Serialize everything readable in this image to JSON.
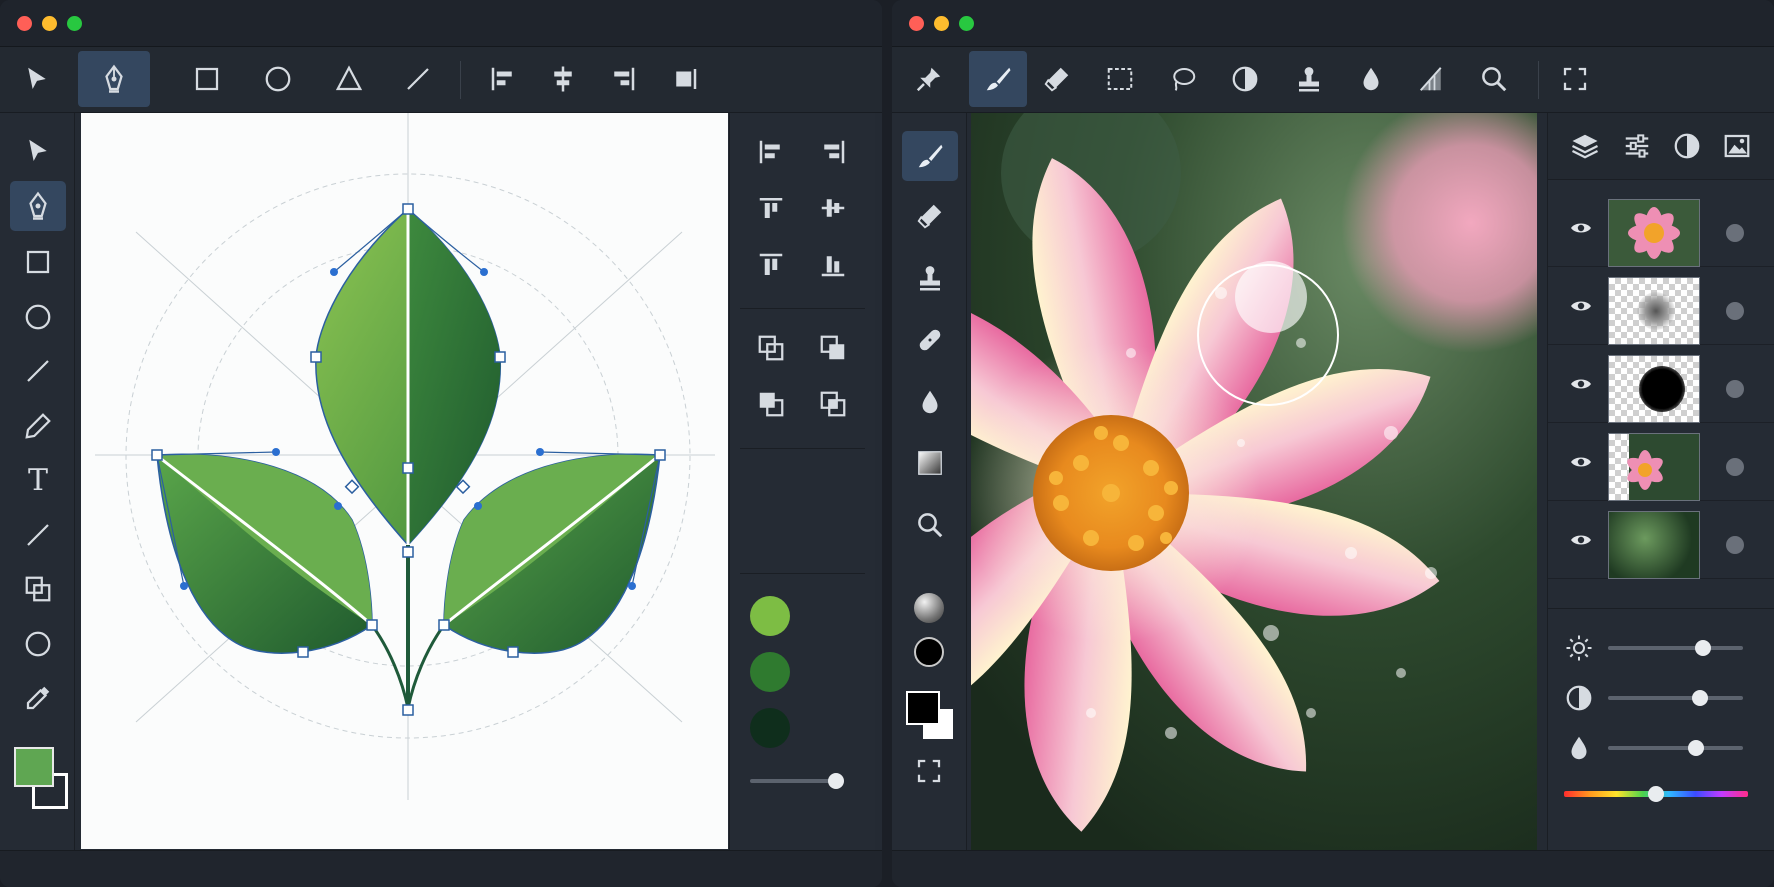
{
  "colors": {
    "close": "#ff5f57",
    "minimize": "#febc2e",
    "zoom": "#28c840",
    "accent": "#34475f",
    "icon": "#d6dbe1"
  },
  "vector_app": {
    "toolbar": [
      "select-icon",
      "pen-icon",
      "rectangle-icon",
      "ellipse-icon",
      "triangle-icon",
      "line-icon",
      "align-left-icon",
      "align-center-icon",
      "align-right-icon",
      "distribute-icon"
    ],
    "active_tool": "pen-icon",
    "left_tools": [
      "select-icon",
      "pen-icon",
      "rectangle-icon",
      "ellipse-icon",
      "line-icon",
      "pencil-icon",
      "text-icon",
      "line-icon",
      "shape-builder-icon",
      "ellipse-icon",
      "eyedropper-icon"
    ],
    "text_tool_glyph": "T",
    "fill_color": "#5fa652",
    "stroke_color": "#ffffff",
    "swatches": [
      "#7dbd44",
      "#2f7a2f",
      "#0f2e1c"
    ],
    "opacity_level": 1.0
  },
  "raster_app": {
    "toolbar": [
      "pin-icon",
      "brush-icon",
      "eraser-icon",
      "marquee-icon",
      "lasso-icon",
      "contrast-icon",
      "stamp-icon",
      "drop-icon",
      "gradient-icon",
      "zoom-icon",
      "fullscreen-icon"
    ],
    "active_tool": "brush-icon",
    "left_tools": [
      "brush-icon",
      "eraser-icon",
      "stamp-icon",
      "bandage-icon",
      "drop-icon",
      "gradient-icon",
      "zoom-icon"
    ],
    "panel_tabs": [
      "layers-icon",
      "sliders-icon",
      "contrast-icon",
      "image-icon"
    ],
    "layers": [
      {
        "thumb": "flower",
        "visible": true
      },
      {
        "thumb": "soft-brush-mask",
        "visible": true
      },
      {
        "thumb": "hard-mask",
        "visible": true
      },
      {
        "thumb": "flower-crop",
        "visible": true
      },
      {
        "thumb": "foliage",
        "visible": true
      }
    ],
    "adjustments": [
      {
        "icon": "sun-icon",
        "level": 0.7
      },
      {
        "icon": "contrast-icon",
        "level": 0.68
      },
      {
        "icon": "drop-icon",
        "level": 0.65
      },
      {
        "icon": "hue-spectrum",
        "level": 0.5
      }
    ]
  }
}
